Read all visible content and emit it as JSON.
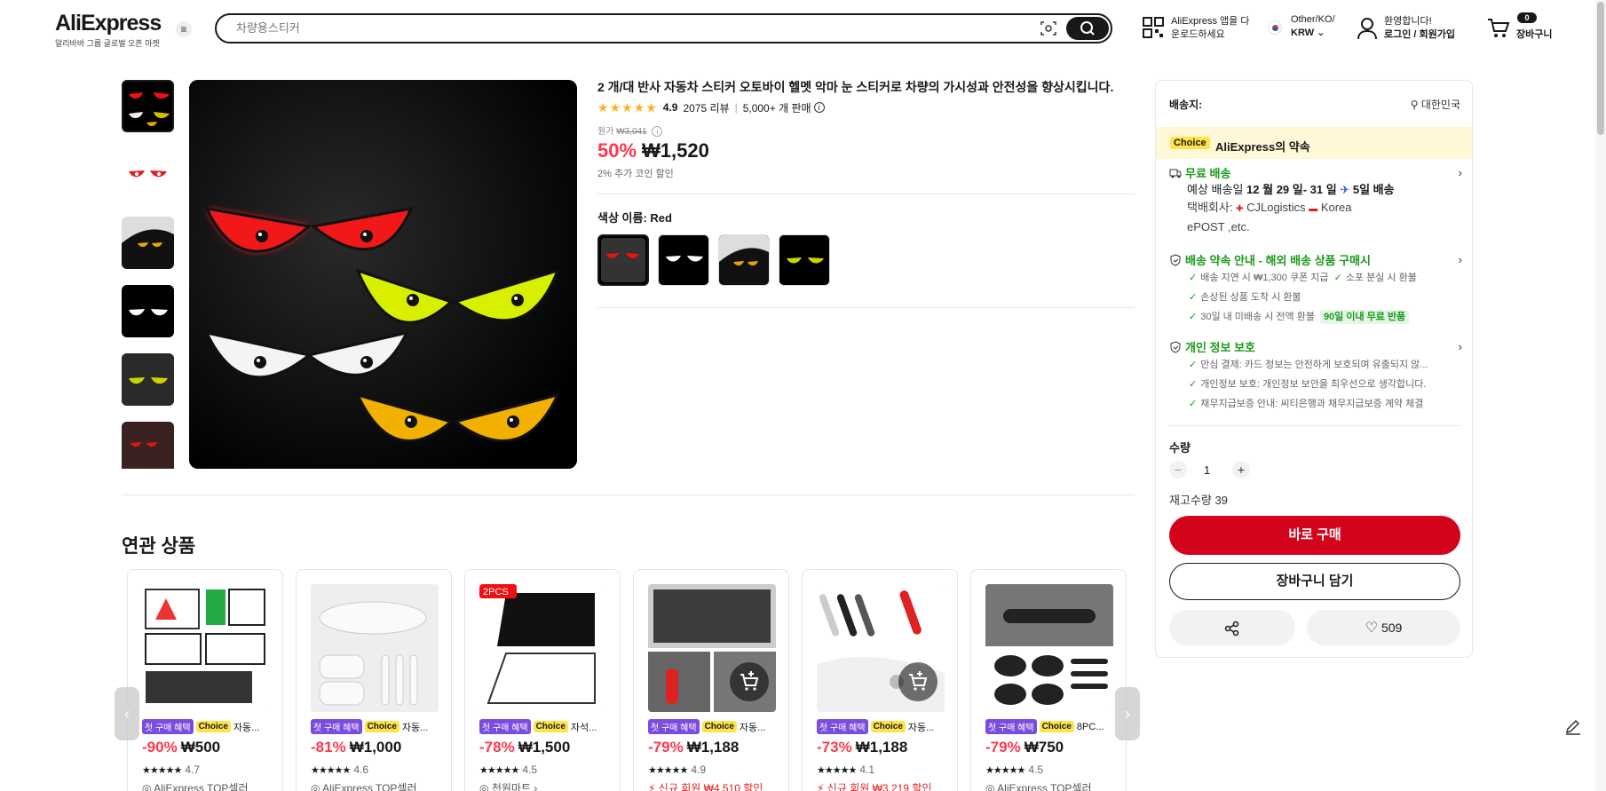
{
  "header": {
    "logo": "AliExpress",
    "logo_sub": "알리바바 그룹 글로벌 오픈 마켓",
    "search_placeholder": "차량용스티커",
    "app_line1": "AliExpress 앱을 다",
    "app_line2": "운로드하세요",
    "lang_line1": "Other/KO/",
    "lang_line2": "KRW",
    "user_line1": "환영합니다!",
    "user_line2": "로그인 / 회원가입",
    "cart_count": "0",
    "cart_label": "장바구니"
  },
  "product": {
    "title": "2 개/대 반사 자동차 스티커 오토바이 헬멧 악마 눈 스티커로 차량의 가시성과 안전성을 향상시킵니다.",
    "stars": "★★★★★",
    "rating": "4.9",
    "reviews": "2075 리뷰",
    "sold": "5,000+ 개 판매",
    "orig_label": "원가",
    "orig_price": "₩3,041",
    "discount": "50%",
    "price": "₩1,520",
    "coin_note": "2% 추가 코인 할인",
    "color_label": "색상 이름: Red"
  },
  "related": {
    "title": "연관 상품",
    "items": [
      {
        "first": "첫 구매 혜택",
        "choice": "Choice",
        "name": "자동...",
        "discount": "-90%",
        "price": "₩500",
        "stars": "★★★★★",
        "rating": "4.7",
        "extra": "AliExpress TOP셀러",
        "extra_red": false
      },
      {
        "first": "첫 구매 혜택",
        "choice": "Choice",
        "name": "자동...",
        "discount": "-81%",
        "price": "₩1,000",
        "stars": "★★★★★",
        "rating": "4.6",
        "extra": "AliExpress TOP셀러",
        "extra_red": false
      },
      {
        "first": "첫 구매 혜택",
        "choice": "Choice",
        "name": "자석...",
        "discount": "-78%",
        "price": "₩1,500",
        "stars": "★★★★★",
        "rating": "4.5",
        "extra": "천원마트 ›",
        "extra_red": false,
        "badge": "2PCS"
      },
      {
        "first": "첫 구매 혜택",
        "choice": "Choice",
        "name": "자동...",
        "discount": "-79%",
        "price": "₩1,188",
        "stars": "★★★★★",
        "rating": "4.9",
        "extra": "신규 회원 ₩4,510 할인",
        "extra_red": true
      },
      {
        "first": "첫 구매 혜택",
        "choice": "Choice",
        "name": "자동...",
        "discount": "-73%",
        "price": "₩1,188",
        "stars": "★★★★★",
        "rating": "4.1",
        "extra": "신규 회원 ₩3,219 할인",
        "extra_red": true
      },
      {
        "first": "첫 구매 혜택",
        "choice": "Choice",
        "name": "8PC...",
        "discount": "-79%",
        "price": "₩750",
        "stars": "★★★★★",
        "rating": "4.5",
        "extra": "AliExpress TOP셀러",
        "extra_red": false
      }
    ]
  },
  "panel": {
    "ship_to_label": "배송지:",
    "ship_to_value": "대한민국",
    "promise_choice": "Choice",
    "promise_title": "AliExpress의 약속",
    "free_ship": "무료 배송",
    "eta_prefix": "예상 배송일",
    "eta_dates": "12 월 29 일- 31 일",
    "eta_days": "5일 배송",
    "carrier": "택배회사:",
    "carrier_1": "CJLogistics",
    "carrier_2": "Korea",
    "carrier_3": "ePOST ,etc.",
    "guarantee_title": "배송 약속 안내 - 해외 배송 상품 구매시",
    "g1": "배송 지연 시 ₩1,300 쿠폰 지급",
    "g2": "소포 분실 시 환불",
    "g3": "손상된 상품 도착 시 환불",
    "g4": "30일 내 미배송 시 전액 환불",
    "g4_badge": "90일 이내 무료 반품",
    "privacy_title": "개인 정보 보호",
    "p1": "안심 결제: 카드 정보는 안전하게 보호되며 유출되지 않...",
    "p2": "개인정보 보호: 개인정보 보안을 최우선으로 생각합니다.",
    "p3": "채무지급보증 안내: 씨티은행과 채무지급보증 계약 체결",
    "qty_label": "수량",
    "qty_minus": "−",
    "qty_value": "1",
    "qty_plus": "+",
    "stock": "재고수량 39",
    "buy_now": "바로 구매",
    "add_cart": "장바구니 담기",
    "wishlist_count": "509"
  },
  "colors": {
    "accent_red": "#fd384f",
    "buy_red": "#d3031c",
    "green": "#1a9a1a",
    "choice_yellow": "#ffe34a"
  }
}
